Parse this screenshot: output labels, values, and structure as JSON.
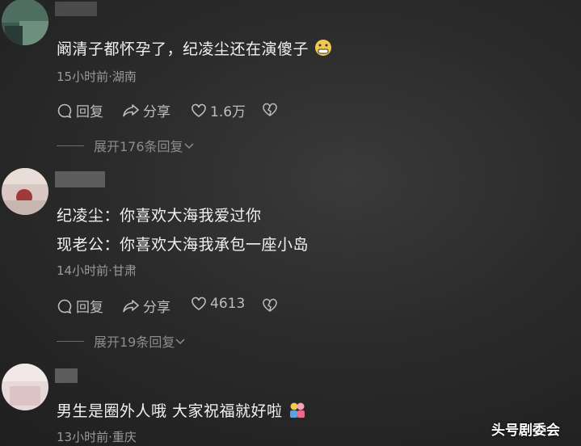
{
  "comments": [
    {
      "lines": [
        "阚清子都怀孕了，纪凌尘还在演傻子"
      ],
      "emoji": "grimace-emoji",
      "meta": "15小时前·湖南",
      "reply_label": "回复",
      "share_label": "分享",
      "like_count": "1.6万",
      "expand_label": "展开176条回复"
    },
    {
      "lines": [
        "纪凌尘：你喜欢大海我爱过你",
        "现老公：你喜欢大海我承包一座小岛"
      ],
      "meta": "14小时前·甘肃",
      "reply_label": "回复",
      "share_label": "分享",
      "like_count": "4613",
      "expand_label": "展开19条回复"
    },
    {
      "lines": [
        "男生是圈外人哦 大家祝福就好啦"
      ],
      "emoji": "couple-emoji",
      "meta": "13小时前·重庆"
    }
  ],
  "watermark": "头号剧委会",
  "colors": {
    "background": "#2b2b2b",
    "text": "#f1f1f1",
    "meta": "#9a9a9a"
  }
}
